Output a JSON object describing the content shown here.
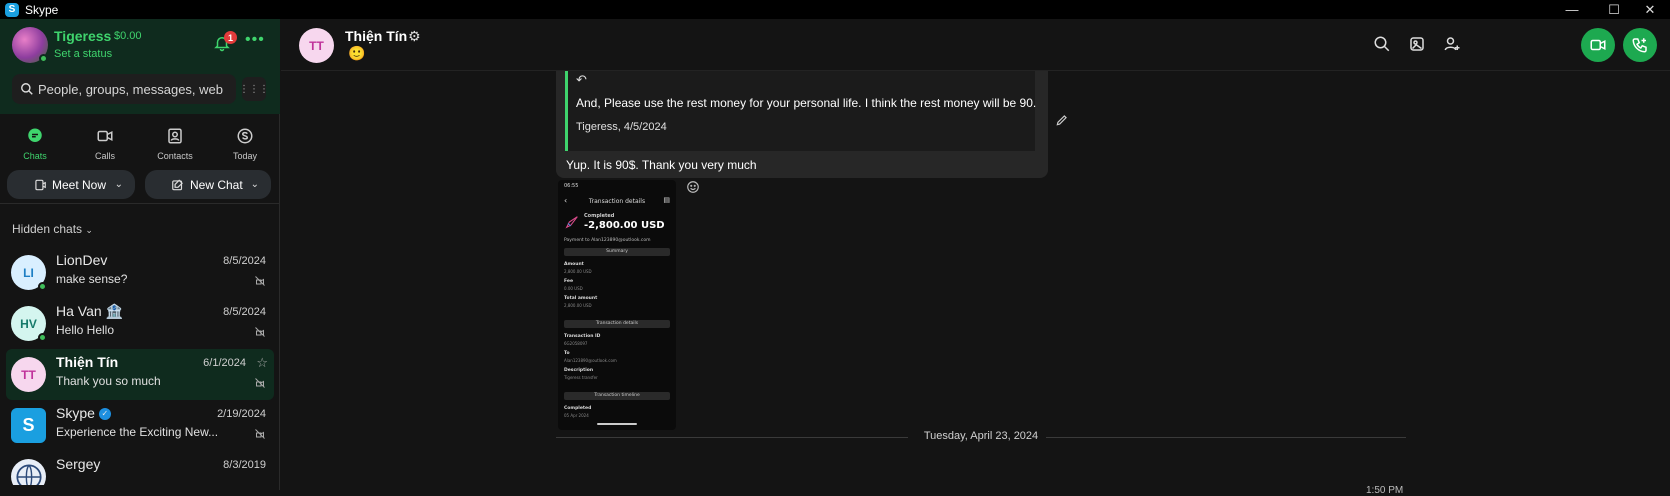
{
  "window": {
    "title": "Skype",
    "minimize_icon": "minimize-icon",
    "maximize_icon": "maximize-icon",
    "close_icon": "close-icon"
  },
  "profile": {
    "name": "Tigeress",
    "balance": "$0.00",
    "status_link": "Set a status",
    "notification_count": "1"
  },
  "search": {
    "placeholder": "People, groups, messages, web"
  },
  "nav_tabs": [
    {
      "label": "Chats",
      "icon": "chat-bubble-icon",
      "active": true
    },
    {
      "label": "Calls",
      "icon": "video-camera-icon",
      "active": false
    },
    {
      "label": "Contacts",
      "icon": "contact-card-icon",
      "active": false
    },
    {
      "label": "Today",
      "icon": "skype-logo-icon",
      "active": false
    }
  ],
  "buttons": {
    "meet_now": "Meet Now",
    "new_chat": "New Chat"
  },
  "hidden_chats_label": "Hidden chats",
  "chats": [
    {
      "initials": "LI",
      "name": "LionDev",
      "date": "8/5/2024",
      "snippet": "make sense?",
      "online": true,
      "selected": false,
      "avatar_bg": "#d9efff",
      "avatar_fg": "#1d7fc4"
    },
    {
      "initials": "HV",
      "name": "Ha Van 🏦",
      "date": "8/5/2024",
      "snippet": "Hello Hello",
      "online": true,
      "selected": false,
      "avatar_bg": "#d4f5ef",
      "avatar_fg": "#167a6b"
    },
    {
      "initials": "TT",
      "name": "Thiện Tín",
      "date": "6/1/2024",
      "snippet": "Thank you so much",
      "online": false,
      "selected": true,
      "avatar_bg": "#f7d7ee",
      "avatar_fg": "#c0329b"
    },
    {
      "initials": "S",
      "name": "Skype",
      "date": "2/19/2024",
      "snippet": "Experience the Exciting New...",
      "online": false,
      "selected": false,
      "avatar_bg": "#1a9fe0",
      "avatar_fg": "#ffffff"
    },
    {
      "initials": "",
      "name": "Sergey",
      "date": "8/3/2019",
      "snippet": "",
      "online": false,
      "selected": false,
      "avatar_bg": "#e8eef7",
      "avatar_fg": "#2c4a7a"
    }
  ],
  "conversation": {
    "contact_name": "Thiện Tín",
    "contact_initials": "TT",
    "mood": "🙂",
    "quoted_text": "And, Please use the rest money for your personal life. I think the rest money will be 90.",
    "quoted_meta": "Tigeress, 4/5/2024",
    "message_text": "Yup. It is 90$. Thank you very much",
    "date_separator": "Tuesday, April 23, 2024",
    "time_partial": "1:50 PM"
  },
  "screenshot_attachment": {
    "status_time": "06:55",
    "title": "Transaction details",
    "state": "Completed",
    "amount": "-2,800.00 USD",
    "payment_to": "Payment to Alan123890@outlook.com",
    "summary_header": "Summary",
    "amount_label": "Amount",
    "amount_value": "2,800.00 USD",
    "fee_label": "Fee",
    "fee_value": "0.00 USD",
    "total_label": "Total amount",
    "total_value": "2,800.00 USD",
    "details_header": "Transaction details",
    "txid_label": "Transaction ID",
    "txid_value": "6G2058097",
    "to_label": "To",
    "to_value": "Alan123890@outlook.com",
    "desc_label": "Description",
    "desc_value": "Tigeress transfer",
    "timeline_header": "Transaction timeline",
    "timeline_state": "Completed",
    "timeline_date": "05 Apr 2024"
  },
  "colors": {
    "accent_green": "#3fd46d",
    "call_green": "#1da950",
    "sidebar_profile_bg": "#0f2b1e",
    "badge_red": "#e23b3b"
  }
}
